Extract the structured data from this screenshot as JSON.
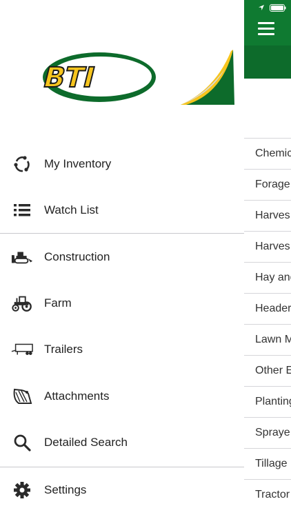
{
  "brand": {
    "logo_text": "BTI",
    "colors": {
      "green": "#0d6b2b",
      "yellow": "#f7c51e",
      "dark": "#1a1a1a"
    }
  },
  "drawer": {
    "items": [
      {
        "label": "My Inventory",
        "icon": "recycle-arrows-icon"
      },
      {
        "label": "Watch List",
        "icon": "list-icon"
      },
      {
        "label": "Construction",
        "icon": "bulldozer-icon"
      },
      {
        "label": "Farm",
        "icon": "tractor-icon"
      },
      {
        "label": "Trailers",
        "icon": "trailer-icon"
      },
      {
        "label": "Attachments",
        "icon": "bucket-attachment-icon"
      },
      {
        "label": "Detailed Search",
        "icon": "search-icon"
      },
      {
        "label": "Settings",
        "icon": "gear-icon"
      }
    ]
  },
  "content": {
    "categories": [
      "Chemic",
      "Forage",
      "Harves",
      "Harves",
      "Hay and",
      "Header",
      "Lawn M",
      "Other E",
      "Planting",
      "Spraye",
      "Tillage",
      "Tractor"
    ]
  }
}
